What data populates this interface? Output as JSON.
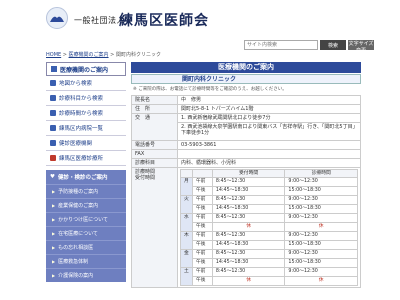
{
  "header": {
    "org_type": "一般社団法人",
    "org_name": "練馬区医師会"
  },
  "search": {
    "placeholder": "サイト内検索",
    "button_label": "検索",
    "size_label": "文字サイズ変更"
  },
  "breadcrumb": {
    "home": "HOME",
    "sep": " > ",
    "parent": "医療機関のご案内",
    "current": "関町内科クリニック"
  },
  "sidebar": {
    "head": "医療機関のご案内",
    "items": [
      {
        "label": "地図から検索"
      },
      {
        "label": "診療科目から検索"
      },
      {
        "label": "診療時間から検索"
      },
      {
        "label": "練馬区内病院一覧"
      },
      {
        "label": "健診医療機関"
      },
      {
        "label": "練馬区医療診療所"
      }
    ],
    "sub_head": "健診・検診のご案内",
    "subs": [
      {
        "label": "予防接種のご案内"
      },
      {
        "label": "産業保健のご案内"
      },
      {
        "label": "かかりつけ医について"
      },
      {
        "label": "在宅医療について"
      },
      {
        "label": "もの忘れ相談医"
      },
      {
        "label": "医療救急体制"
      },
      {
        "label": "介護保険の案内"
      }
    ]
  },
  "main": {
    "title": "医療機関のご案内",
    "clinic": "関町内科クリニック",
    "notice": "※ ご来院の際は、お電話にて診療時間等をご確認のうえ、お越しください。",
    "rows": [
      {
        "k": "院長名",
        "v": "中　修男"
      },
      {
        "k": "住　所",
        "v": "関町北5-8-1 トパーズハイム1階"
      },
      {
        "k": "交　通",
        "v": "1. 西武新宿線武蔵関駅北口より徒歩7分"
      },
      {
        "k": "",
        "v": "2. 西武池袋線大泉学園駅南口より関東バス「吉祥寺駅」行き、「関町北5丁目」下車徒歩1分"
      },
      {
        "k": "電話番号",
        "v": "03-5903-3861"
      },
      {
        "k": "FAX",
        "v": ""
      },
      {
        "k": "診療科目",
        "v": "内科、循環器科、小児科"
      }
    ],
    "sched_label": "診療時間\n受付時間",
    "sched_head": {
      "recv": "受付時間",
      "treat": "診療時間"
    },
    "schedule": [
      {
        "day": "月",
        "am_r": "8:45～12:30",
        "am_t": "9:00～12:30",
        "pm_r": "14:45～18:30",
        "pm_t": "15:00～18:30"
      },
      {
        "day": "火",
        "am_r": "8:45～12:30",
        "am_t": "9:00～12:30",
        "pm_r": "14:45～18:30",
        "pm_t": "15:00～18:30"
      },
      {
        "day": "水",
        "am_r": "8:45～12:30",
        "am_t": "9:00～12:30",
        "pm_r": "休",
        "pm_t": "休"
      },
      {
        "day": "木",
        "am_r": "8:45～12:30",
        "am_t": "9:00～12:30",
        "pm_r": "14:45～18:30",
        "pm_t": "15:00～18:30"
      },
      {
        "day": "金",
        "am_r": "8:45～12:30",
        "am_t": "9:00～12:30",
        "pm_r": "14:45～18:30",
        "pm_t": "15:00～18:30"
      },
      {
        "day": "土",
        "am_r": "8:45～12:30",
        "am_t": "9:00～12:30",
        "pm_r": "休",
        "pm_t": "休"
      }
    ],
    "am": "午前",
    "pm": "午後"
  }
}
